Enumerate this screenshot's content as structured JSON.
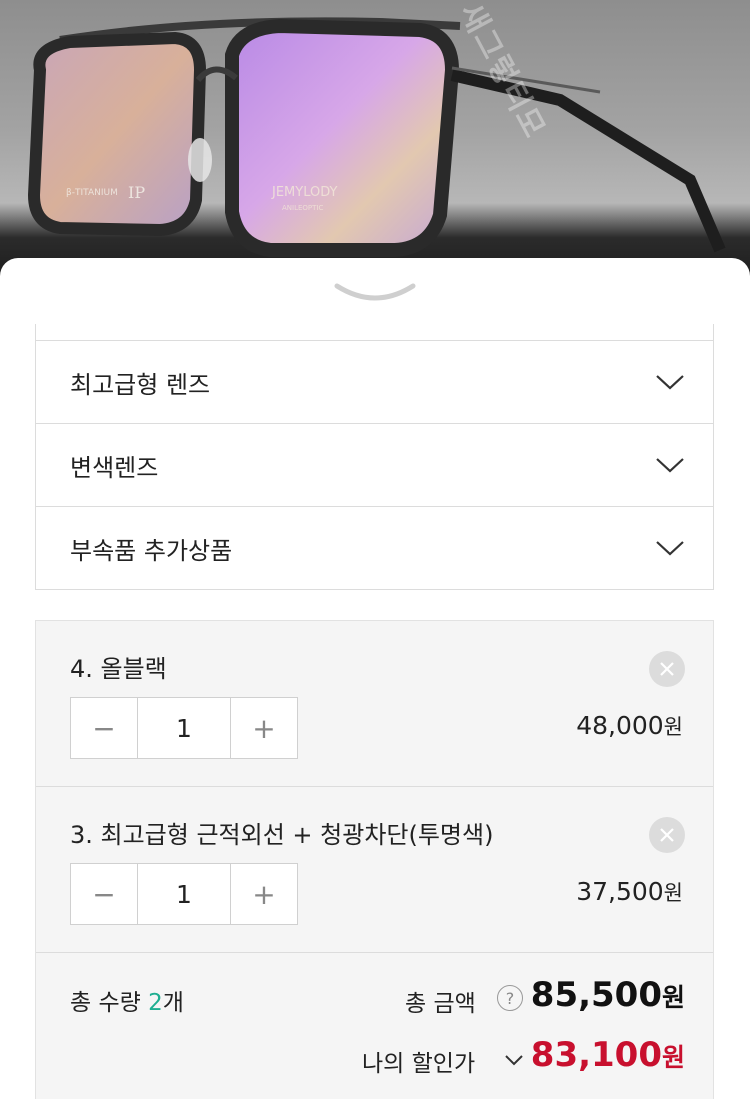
{
  "photo": {
    "brand_text": "JEMYLODY",
    "brand_subtext": "ANILEOPTIC",
    "temple_text": "β-TITANIUM",
    "temple_mark": "IP",
    "watermark_text": "새그렇티모"
  },
  "options": [
    {
      "label": "최고급형 렌즈"
    },
    {
      "label": "변색렌즈"
    },
    {
      "label": "부속품 추가상품"
    }
  ],
  "items": [
    {
      "name": "4. 올블랙",
      "quantity": "1",
      "price": "48,000",
      "currency": "원",
      "minus": "−",
      "plus": "+"
    },
    {
      "name": "3. 최고급형 근적외선 + 청광차단(투명색)",
      "quantity": "1",
      "price": "37,500",
      "currency": "원",
      "minus": "−",
      "plus": "+"
    }
  ],
  "summary": {
    "quantity_label": "총 수량",
    "quantity_value": "2",
    "quantity_unit": "개",
    "total_label": "총 금액",
    "help_glyph": "?",
    "total_value": "85,500",
    "total_unit": "원",
    "discount_label": "나의 할인가",
    "discount_value": "83,100",
    "discount_unit": "원"
  },
  "colors": {
    "accent_green": "#1fae91",
    "discount_red": "#c8102e"
  }
}
